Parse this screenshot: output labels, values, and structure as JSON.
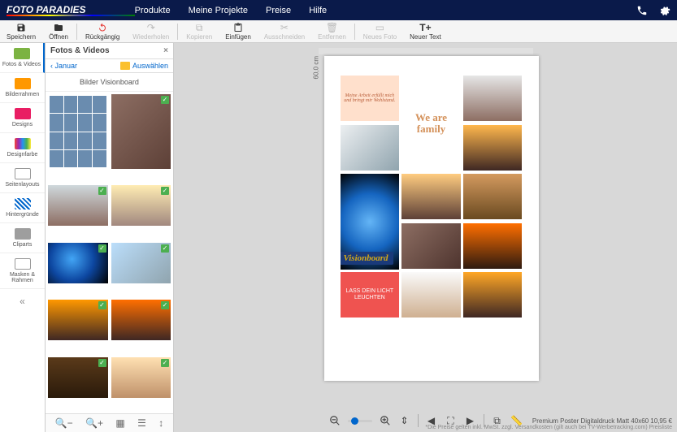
{
  "header": {
    "logo": "FOTO PARADIES",
    "nav": [
      "Produkte",
      "Meine Projekte",
      "Preise",
      "Hilfe"
    ]
  },
  "toolbar": {
    "save": "Speichern",
    "open": "Öffnen",
    "undo": "Rückgängig",
    "redo": "Wiederholen",
    "copy": "Kopieren",
    "paste": "Einfügen",
    "cut": "Ausschneiden",
    "delete": "Entfernen",
    "newphoto": "Neues Foto",
    "newtext": "Neuer Text"
  },
  "sidebar": {
    "photos": "Fotos & Videos",
    "frames": "Bilderrahmen",
    "designs": "Designs",
    "color": "Designfarbe",
    "layouts": "Seitenlayouts",
    "backgrounds": "Hintergründe",
    "cliparts": "Cliparts",
    "masks": "Masken & Rahmen"
  },
  "panel": {
    "header": "Fotos & Videos",
    "back": "Januar",
    "select": "Auswählen",
    "title": "Bilder Visionboard"
  },
  "canvas": {
    "height_label": "60,0 cm",
    "text_arbeit": "Meine Arbeit erfüllt mich und bringt mir Wohlstand.",
    "text_family": "We are family",
    "text_visionboard": "Visionboard",
    "text_licht": "LASS DEIN LICHT LEUCHTEN"
  },
  "status": {
    "product": "Premium Poster Digitaldruck Matt 40x60 10,95 €",
    "note": "*Die Preise gelten inkl. MwSt. zzgl. Versandkosten (gilt auch bei TV-Werbetracking.com) Preisliste"
  }
}
